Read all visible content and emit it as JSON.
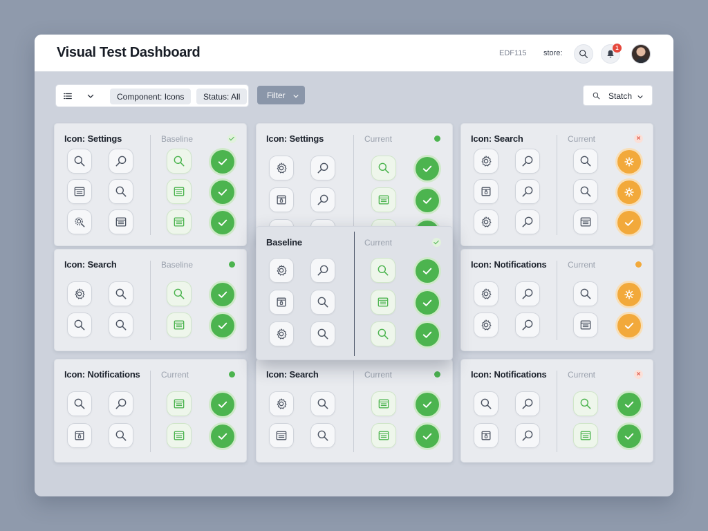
{
  "header": {
    "title": "Visual Test Dashboard",
    "code": "EDF115",
    "store_label": "store:",
    "notification_count": "1"
  },
  "toolbar": {
    "component_filter": "Component: Icons",
    "status_filter": "Status: All",
    "filter_button": "Filter",
    "search_label": "Statch"
  },
  "colors": {
    "pass": "#4cb44f",
    "warning": "#f2a93b",
    "error": "#e0584a"
  },
  "cards": [
    {
      "title": "Icon: Settings",
      "compare_label": "Baseline",
      "status": "check"
    },
    {
      "title": "Icon: Settings",
      "compare_label": "Current",
      "status": "green"
    },
    {
      "title": "Icon: Search",
      "compare_label": "Current",
      "status": "error"
    },
    {
      "title": "Icon: Search",
      "compare_label": "Baseline",
      "status": "green"
    },
    {
      "title": "Baseline",
      "compare_label": "Current",
      "status": "check"
    },
    {
      "title": "Icon: Notifications",
      "compare_label": "Current",
      "status": "orange"
    },
    {
      "title": "Icon: Notifications",
      "compare_label": "Current",
      "status": "green"
    },
    {
      "title": "Icon: Search",
      "compare_label": "Current",
      "status": "green"
    },
    {
      "title": "Icon: Notifications",
      "compare_label": "Current",
      "status": "error"
    }
  ]
}
